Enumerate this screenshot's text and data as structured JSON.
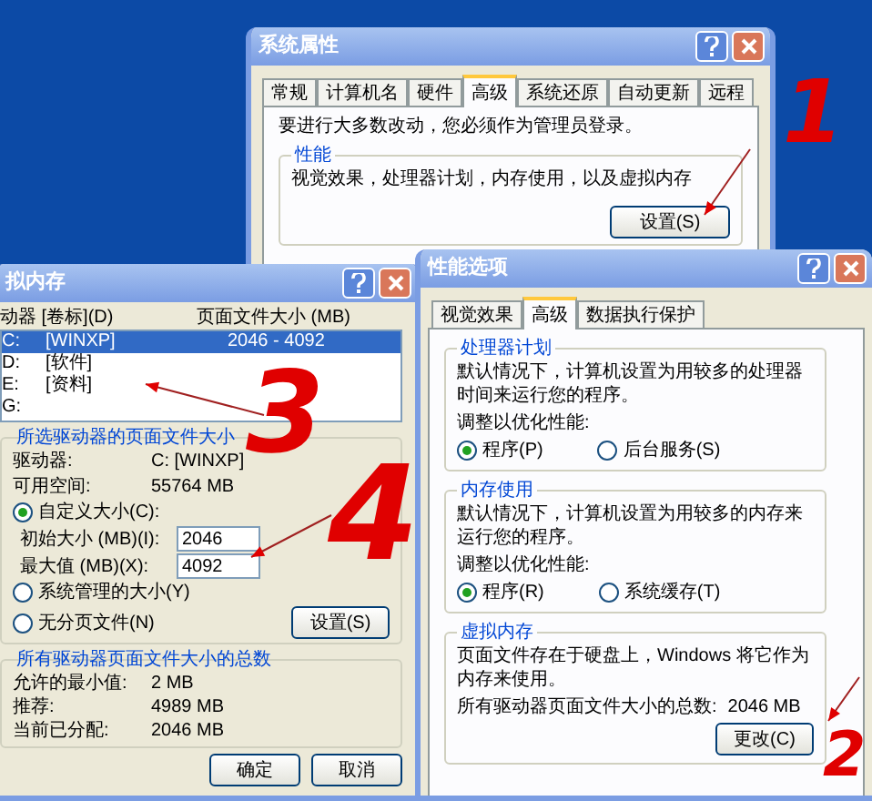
{
  "system_properties": {
    "title": "系统属性",
    "tabs": [
      {
        "label": "常规",
        "selected": false
      },
      {
        "label": "计算机名",
        "selected": false
      },
      {
        "label": "硬件",
        "selected": false
      },
      {
        "label": "高级",
        "selected": true
      },
      {
        "label": "系统还原",
        "selected": false
      },
      {
        "label": "自动更新",
        "selected": false
      },
      {
        "label": "远程",
        "selected": false
      }
    ],
    "notice": "要进行大多数改动，您必须作为管理员登录。",
    "performance": {
      "label": "性能",
      "description": "视觉效果，处理器计划，内存使用，以及虚拟内存",
      "button": "设置(S)"
    }
  },
  "virtual_memory": {
    "title": "拟内存",
    "columns": [
      "动器 [卷标](D)",
      "页面文件大小 (MB)"
    ],
    "drives": [
      {
        "drive": "C:",
        "label": "[WINXP]",
        "size": "2046 - 4092",
        "selected": true
      },
      {
        "drive": "D:",
        "label": "[软件]",
        "selected": false
      },
      {
        "drive": "E:",
        "label": "[资料]",
        "selected": false
      },
      {
        "drive": "G:",
        "selected": false
      }
    ],
    "selected_drive": {
      "label": "所选驱动器的页面文件大小",
      "drive_label": "驱动器:",
      "drive_value": "C:  [WINXP]",
      "space_label": "可用空间:",
      "space_value": "55764 MB",
      "options": [
        {
          "label": "自定义大小(C):",
          "selected": true
        },
        {
          "label": "系统管理的大小(Y)",
          "selected": false
        },
        {
          "label": "无分页文件(N)",
          "selected": false
        }
      ],
      "initial_label": "初始大小 (MB)(I):",
      "initial_value": "2046",
      "max_label": "最大值 (MB)(X):",
      "max_value": "4092",
      "set_button": "设置(S)"
    },
    "totals": {
      "label": "所有驱动器页面文件大小的总数",
      "rows": [
        {
          "name": "允许的最小值:",
          "value": "2 MB"
        },
        {
          "name": "推荐:",
          "value": "4989 MB"
        },
        {
          "name": "当前已分配:",
          "value": "2046 MB"
        }
      ]
    },
    "buttons": [
      "确定",
      "取消"
    ]
  },
  "performance_options": {
    "title": "性能选项",
    "tabs": [
      {
        "label": "视觉效果",
        "selected": false
      },
      {
        "label": "高级",
        "selected": true
      },
      {
        "label": "数据执行保护",
        "selected": false
      }
    ],
    "processor": {
      "label": "处理器计划",
      "description": "默认情况下，计算机设置为用较多的处理器时间来运行您的程序。",
      "adjust": "调整以优化性能:",
      "options": [
        {
          "label": "程序(P)",
          "selected": true
        },
        {
          "label": "后台服务(S)",
          "selected": false
        }
      ]
    },
    "memory": {
      "label": "内存使用",
      "description": "默认情况下，计算机设置为用较多的内存来运行您的程序。",
      "adjust": "调整以优化性能:",
      "options": [
        {
          "label": "程序(R)",
          "selected": true
        },
        {
          "label": "系统缓存(T)",
          "selected": false
        }
      ]
    },
    "virtual": {
      "label": "虚拟内存",
      "description": "页面文件存在于硬盘上，Windows 将它作为内存来使用。",
      "total_label": "所有驱动器页面文件大小的总数:",
      "total_value": "2046 MB",
      "button": "更改(C)"
    }
  },
  "annotations": [
    {
      "text": "1"
    },
    {
      "text": "3"
    },
    {
      "text": "4"
    },
    {
      "text": "2"
    }
  ]
}
